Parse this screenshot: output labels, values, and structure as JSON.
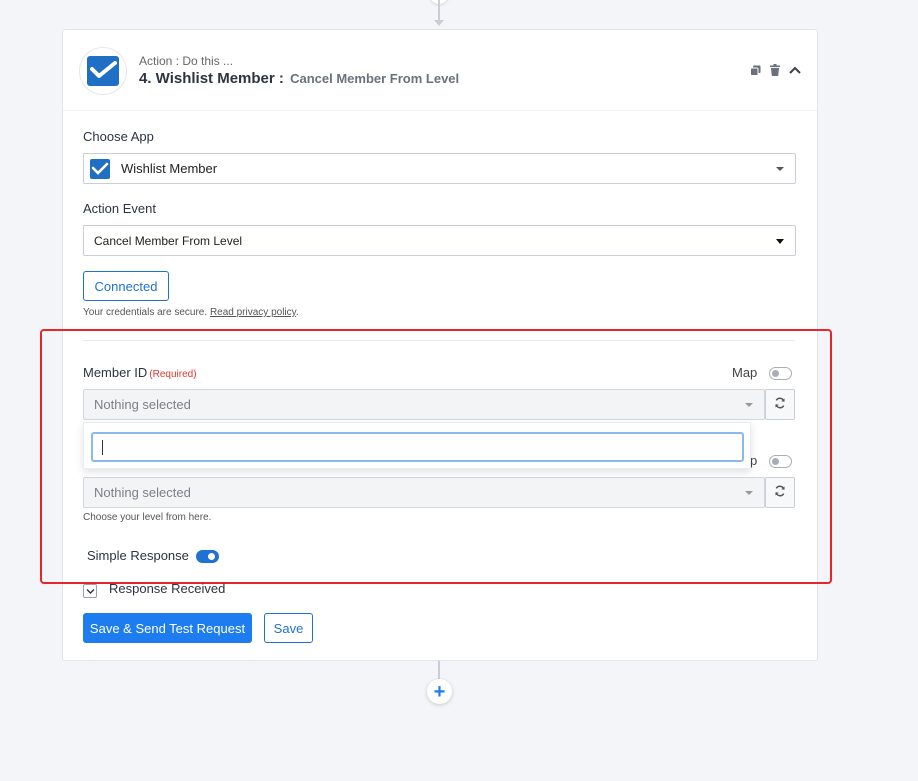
{
  "header": {
    "subtitle": "Action : Do this ...",
    "title": "4. Wishlist Member :",
    "event": "Cancel Member From Level",
    "icons": [
      "copy-icon",
      "trash-icon",
      "chevron-up-icon"
    ]
  },
  "choose_app": {
    "label": "Choose App",
    "value": "Wishlist Member",
    "icon": "wishlist-logo-icon"
  },
  "action_event": {
    "label": "Action Event",
    "value": "Cancel Member From Level"
  },
  "connection": {
    "button_label": "Connected",
    "note_prefix": "Your credentials are secure.",
    "note_link": "Read privacy policy",
    "note_suffix": "."
  },
  "member_id": {
    "label": "Member ID",
    "required": "(Required)",
    "map_label": "Map",
    "placeholder": "Nothing selected",
    "search_value": ""
  },
  "level": {
    "map_label": "p",
    "placeholder": "Nothing selected",
    "hint": "Choose your level from here."
  },
  "simple_response": {
    "label": "Simple Response",
    "enabled": true
  },
  "response_received": {
    "label": "Response Received"
  },
  "actions": {
    "send_test_label": "Save & Send Test Request",
    "save_label": "Save",
    "add_icon": "+"
  },
  "colors": {
    "accent": "#1d7cf0",
    "highlight_border": "#e6262d"
  }
}
